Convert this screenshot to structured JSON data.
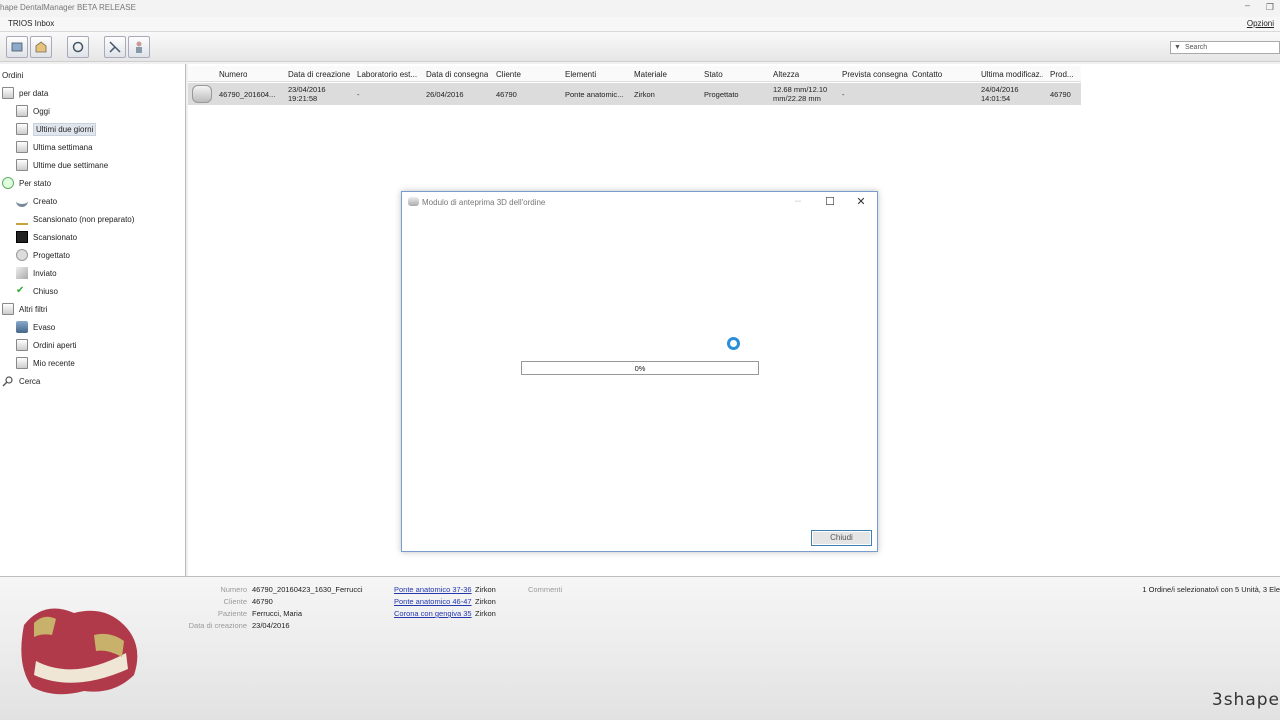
{
  "window": {
    "title": "hape DentalManager BETA RELEASE",
    "menu_tab": "TRIOS Inbox",
    "options": "Opzioni"
  },
  "search": {
    "placeholder": "Search"
  },
  "sidebar": {
    "root": "Ordini",
    "groups": [
      {
        "label": "per data",
        "icon": "calendar-icon"
      },
      {
        "label": "Oggi",
        "icon": "calendar-icon"
      },
      {
        "label": "Ultimi due giorni",
        "icon": "calendar-icon"
      },
      {
        "label": "Ultima settimana",
        "icon": "calendar-icon"
      },
      {
        "label": "Ultime due settimane",
        "icon": "calendar-icon"
      },
      {
        "label": "Per stato",
        "icon": "status-icon"
      },
      {
        "label": "Creato",
        "icon": "created-icon"
      },
      {
        "label": "Scansionato (non preparato)",
        "icon": "scan-unprepared-icon"
      },
      {
        "label": "Scansionato",
        "icon": "scanned-icon"
      },
      {
        "label": "Progettato",
        "icon": "designed-icon"
      },
      {
        "label": "Inviato",
        "icon": "sent-icon"
      },
      {
        "label": "Chiuso",
        "icon": "closed-icon"
      },
      {
        "label": "Altri filtri",
        "icon": "filter-icon"
      },
      {
        "label": "Evaso",
        "icon": "shipped-icon"
      },
      {
        "label": "Ordini aperti",
        "icon": "open-orders-icon"
      },
      {
        "label": "Mio recente",
        "icon": "recent-icon"
      },
      {
        "label": "Cerca",
        "icon": "search-icon"
      }
    ]
  },
  "table": {
    "headers": [
      "Numero",
      "Data di creazione",
      "Laboratorio est...",
      "Data di consegna",
      "Cliente",
      "Elementi",
      "Materiale",
      "Stato",
      "Altezza",
      "Prevista consegna",
      "Contatto",
      "Ultima modificaz...",
      "Prod..."
    ],
    "row": {
      "numero": "46790_201604...",
      "creazione_1": "23/04/2016",
      "creazione_2": "19:21:58",
      "laboratorio": "-",
      "consegna": "26/04/2016",
      "cliente": "46790",
      "elementi": "Ponte anatomic...",
      "materiale": "Zirkon",
      "stato": "Progettato",
      "altezza_1": "12.68 mm/12.10",
      "altezza_2": "mm/22.28 mm",
      "prevista": "-",
      "contatto": "",
      "modifica_1": "24/04/2016",
      "modifica_2": "14:01:54",
      "prod": "46790"
    }
  },
  "dialog": {
    "title": "Modulo di anteprima 3D dell'ordine",
    "progress_text": "0%",
    "progress_value": 0,
    "close_button": "Chiudi"
  },
  "details": {
    "numero_label": "Numero",
    "numero": "46790_20160423_1630_Ferrucci",
    "cliente_label": "Cliente",
    "cliente": "46790",
    "paziente_label": "Paziente",
    "paziente": "Ferrucci, Maria",
    "data_label": "Data di creazione",
    "data": "23/04/2016",
    "items": [
      {
        "link": "Ponte anatomico 37-36",
        "material": "Zirkon"
      },
      {
        "link": "Ponte anatomico 46-47",
        "material": "Zirkon"
      },
      {
        "link": "Corona con gengiva 35",
        "material": "Zirkon"
      }
    ],
    "comments_label": "Commenti",
    "status": "1 Ordine/i selezionato/i con 5 Unità, 3 Ele",
    "brand": "3shape"
  }
}
